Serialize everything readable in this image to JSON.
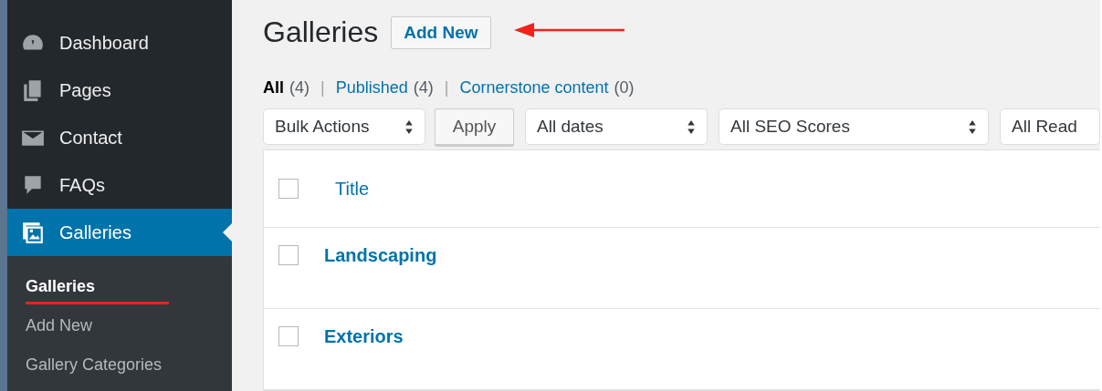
{
  "sidebar": {
    "items": [
      {
        "label": "Dashboard",
        "selected": false
      },
      {
        "label": "Pages",
        "selected": false
      },
      {
        "label": "Contact",
        "selected": false
      },
      {
        "label": "FAQs",
        "selected": false
      },
      {
        "label": "Galleries",
        "selected": true
      }
    ],
    "submenu": [
      {
        "label": "Galleries",
        "selected": true,
        "underlined": true
      },
      {
        "label": "Add New",
        "selected": false,
        "underlined": false
      },
      {
        "label": "Gallery Categories",
        "selected": false,
        "underlined": false
      }
    ]
  },
  "page_title": "Galleries",
  "add_new_button": "Add New",
  "annotation_arrow": true,
  "views": [
    {
      "label": "All",
      "count": "(4)",
      "selected": true
    },
    {
      "label": "Published",
      "count": "(4)",
      "selected": false
    },
    {
      "label": "Cornerstone content",
      "count": "(0)",
      "selected": false
    }
  ],
  "separator": "|",
  "bulk_actions": "Bulk Actions",
  "apply_button": "Apply",
  "filters": [
    {
      "value": "All dates"
    },
    {
      "value": "All SEO Scores"
    },
    {
      "value": "All Read"
    }
  ],
  "table": {
    "columns": [
      {
        "label": "Title",
        "checked": false
      }
    ],
    "rows": [
      {
        "title": "Landscaping",
        "checked": false
      },
      {
        "title": "Exteriors",
        "checked": false
      }
    ]
  }
}
